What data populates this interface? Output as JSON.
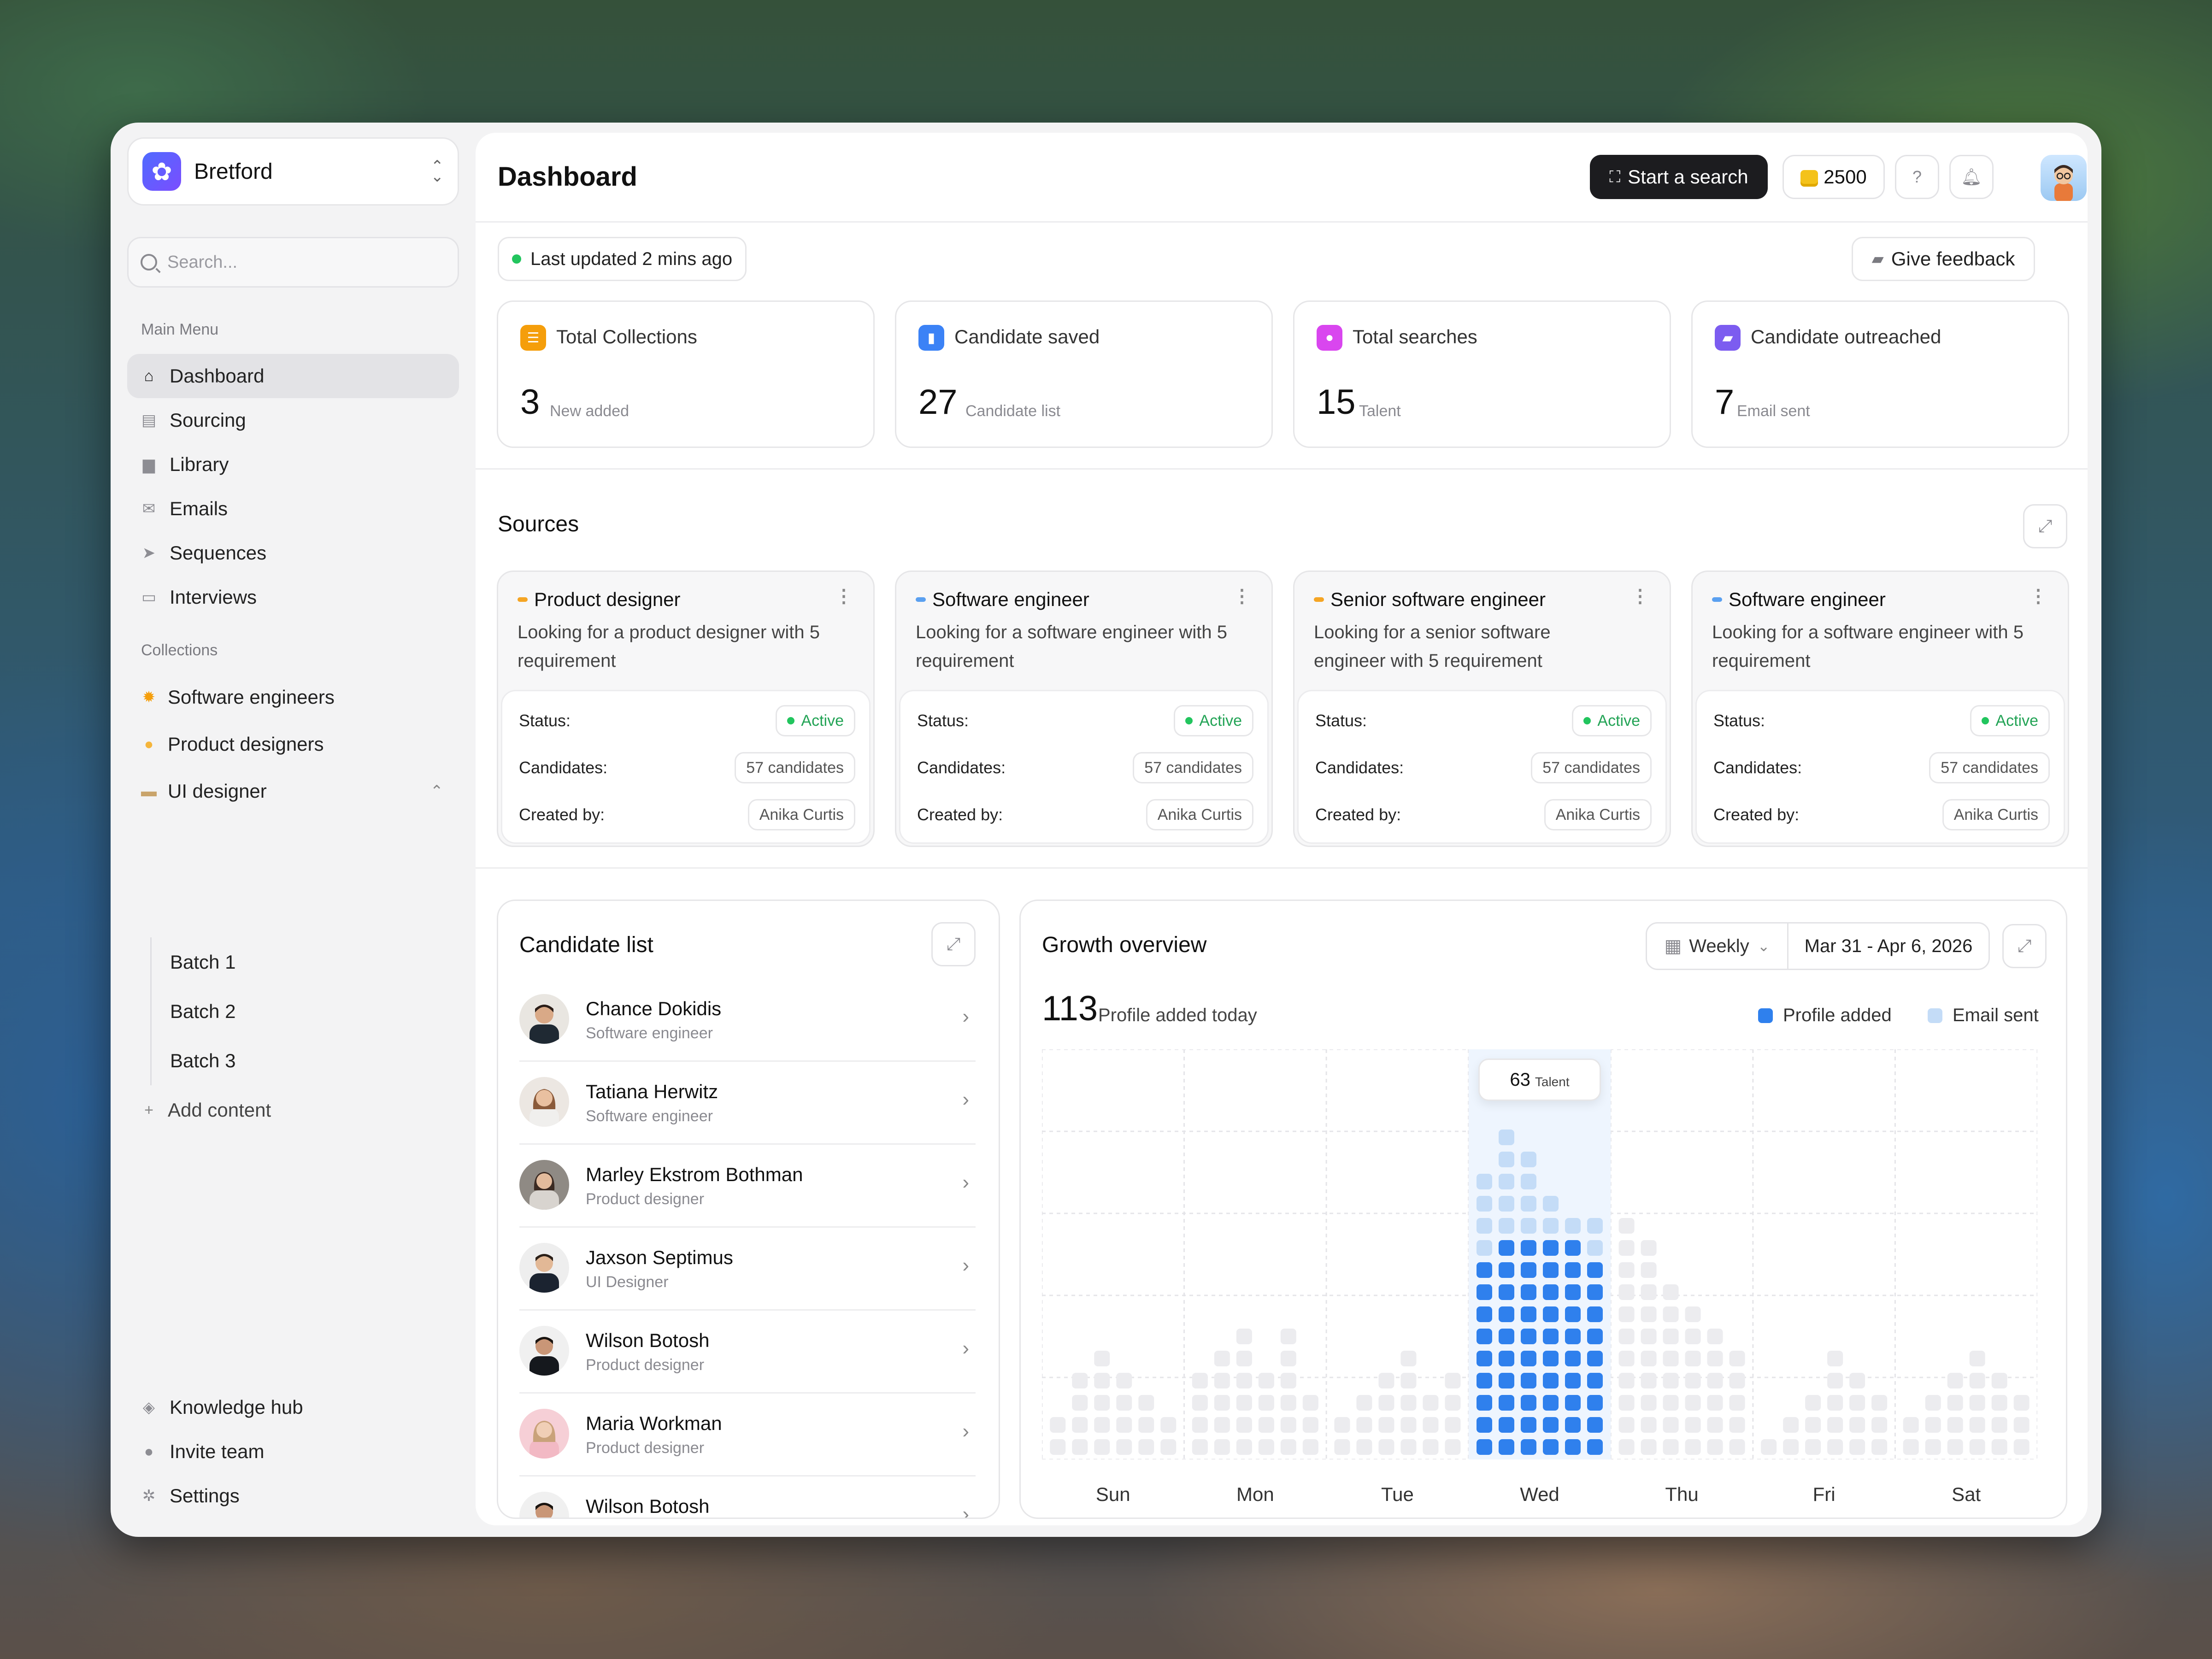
{
  "sidebar": {
    "brand": "Bretford",
    "search_placeholder": "Search...",
    "main_menu_label": "Main Menu",
    "main_menu": [
      {
        "label": "Dashboard",
        "icon": "home-icon",
        "active": true
      },
      {
        "label": "Sourcing",
        "icon": "document-icon"
      },
      {
        "label": "Library",
        "icon": "archive-icon"
      },
      {
        "label": "Emails",
        "icon": "mail-icon"
      },
      {
        "label": "Sequences",
        "icon": "send-icon"
      },
      {
        "label": "Interviews",
        "icon": "monitor-icon"
      }
    ],
    "collections_label": "Collections",
    "collections": [
      {
        "label": "Software engineers",
        "icon": "gear-icon",
        "color": "#f59e0b"
      },
      {
        "label": "Product designers",
        "icon": "palette-icon",
        "color": "#f5b53b"
      },
      {
        "label": "UI designer",
        "icon": "folder-icon",
        "color": "#c9a46b"
      }
    ],
    "ui_designer_children": [
      "Batch 1",
      "Batch 2",
      "Batch 3"
    ],
    "add_content": "Add content",
    "bottom": [
      {
        "label": "Knowledge hub",
        "icon": "cube-icon"
      },
      {
        "label": "Invite team",
        "icon": "user-icon"
      },
      {
        "label": "Settings",
        "icon": "gear-icon"
      }
    ]
  },
  "header": {
    "title": "Dashboard",
    "start_search": "Start a search",
    "credits": "2500"
  },
  "status": {
    "last_updated": "Last updated 2 mins ago",
    "feedback": "Give feedback"
  },
  "stats": [
    {
      "title": "Total Collections",
      "value": "3",
      "sub": "New added",
      "color": "#f59e0b"
    },
    {
      "title": "Candidate saved",
      "value": "27",
      "sub": "Candidate list",
      "color": "#3b82f6"
    },
    {
      "title": "Total searches",
      "value": "15",
      "sub": "Talent",
      "color": "#d946ef"
    },
    {
      "title": "Candidate outreached",
      "value": "7",
      "sub": "Email sent",
      "color": "#7c5cf0"
    }
  ],
  "sources": {
    "title": "Sources",
    "status_label": "Status:",
    "candidates_label": "Candidates:",
    "created_label": "Created by:",
    "items": [
      {
        "title": "Product designer",
        "desc": "Looking for a product designer with 5 requirement",
        "status": "Active",
        "candidates": "57 candidates",
        "created_by": "Anika Curtis",
        "color": "#f5a524"
      },
      {
        "title": "Software engineer",
        "desc": "Looking for a software engineer with 5 requirement",
        "status": "Active",
        "candidates": "57 candidates",
        "created_by": "Anika Curtis",
        "color": "#5aa0f0"
      },
      {
        "title": "Senior software engineer",
        "desc": "Looking for a senior software engineer with 5 requirement",
        "status": "Active",
        "candidates": "57 candidates",
        "created_by": "Anika Curtis",
        "color": "#f5a524"
      },
      {
        "title": "Software engineer",
        "desc": "Looking for a software engineer with 5 requirement",
        "status": "Active",
        "candidates": "57 candidates",
        "created_by": "Anika Curtis",
        "color": "#5aa0f0"
      }
    ]
  },
  "candidates": {
    "title": "Candidate list",
    "items": [
      {
        "name": "Chance Dokidis",
        "role": "Software engineer"
      },
      {
        "name": "Tatiana Herwitz",
        "role": "Software engineer"
      },
      {
        "name": "Marley Ekstrom Bothman",
        "role": "Product designer"
      },
      {
        "name": "Jaxson Septimus",
        "role": "UI Designer"
      },
      {
        "name": "Wilson Botosh",
        "role": "Product designer"
      },
      {
        "name": "Maria Workman",
        "role": "Product designer"
      },
      {
        "name": "Wilson Botosh",
        "role": ""
      }
    ]
  },
  "growth": {
    "title": "Growth overview",
    "period": "Weekly",
    "date_range": "Mar 31 - Apr 6, 2026",
    "today_value": "113",
    "today_label": "Profile added today",
    "legend": [
      {
        "label": "Profile added",
        "color": "#2f80ed"
      },
      {
        "label": "Email sent",
        "color": "#c4dcf7"
      }
    ],
    "tooltip_value": "63",
    "tooltip_label": "Talent"
  },
  "chart_data": {
    "type": "bar",
    "categories": [
      "Sun",
      "Mon",
      "Tue",
      "Wed",
      "Thu",
      "Fri",
      "Sat"
    ],
    "series": [
      {
        "name": "Profile added",
        "values": [
          0,
          0,
          0,
          10,
          0,
          0,
          0
        ]
      },
      {
        "name": "Email sent",
        "values": [
          6,
          7,
          5,
          15,
          12,
          5,
          5
        ]
      }
    ],
    "highlight": {
      "category": "Wed",
      "value": 63,
      "label": "Talent"
    },
    "grid": true
  }
}
